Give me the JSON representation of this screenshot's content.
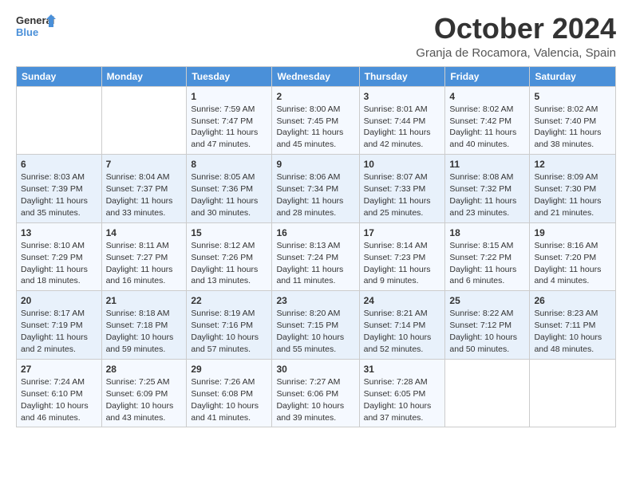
{
  "logo": {
    "line1": "General",
    "line2": "Blue"
  },
  "title": "October 2024",
  "subtitle": "Granja de Rocamora, Valencia, Spain",
  "days_of_week": [
    "Sunday",
    "Monday",
    "Tuesday",
    "Wednesday",
    "Thursday",
    "Friday",
    "Saturday"
  ],
  "weeks": [
    [
      {
        "day": "",
        "info": ""
      },
      {
        "day": "",
        "info": ""
      },
      {
        "day": "1",
        "info": "Sunrise: 7:59 AM\nSunset: 7:47 PM\nDaylight: 11 hours and 47 minutes."
      },
      {
        "day": "2",
        "info": "Sunrise: 8:00 AM\nSunset: 7:45 PM\nDaylight: 11 hours and 45 minutes."
      },
      {
        "day": "3",
        "info": "Sunrise: 8:01 AM\nSunset: 7:44 PM\nDaylight: 11 hours and 42 minutes."
      },
      {
        "day": "4",
        "info": "Sunrise: 8:02 AM\nSunset: 7:42 PM\nDaylight: 11 hours and 40 minutes."
      },
      {
        "day": "5",
        "info": "Sunrise: 8:02 AM\nSunset: 7:40 PM\nDaylight: 11 hours and 38 minutes."
      }
    ],
    [
      {
        "day": "6",
        "info": "Sunrise: 8:03 AM\nSunset: 7:39 PM\nDaylight: 11 hours and 35 minutes."
      },
      {
        "day": "7",
        "info": "Sunrise: 8:04 AM\nSunset: 7:37 PM\nDaylight: 11 hours and 33 minutes."
      },
      {
        "day": "8",
        "info": "Sunrise: 8:05 AM\nSunset: 7:36 PM\nDaylight: 11 hours and 30 minutes."
      },
      {
        "day": "9",
        "info": "Sunrise: 8:06 AM\nSunset: 7:34 PM\nDaylight: 11 hours and 28 minutes."
      },
      {
        "day": "10",
        "info": "Sunrise: 8:07 AM\nSunset: 7:33 PM\nDaylight: 11 hours and 25 minutes."
      },
      {
        "day": "11",
        "info": "Sunrise: 8:08 AM\nSunset: 7:32 PM\nDaylight: 11 hours and 23 minutes."
      },
      {
        "day": "12",
        "info": "Sunrise: 8:09 AM\nSunset: 7:30 PM\nDaylight: 11 hours and 21 minutes."
      }
    ],
    [
      {
        "day": "13",
        "info": "Sunrise: 8:10 AM\nSunset: 7:29 PM\nDaylight: 11 hours and 18 minutes."
      },
      {
        "day": "14",
        "info": "Sunrise: 8:11 AM\nSunset: 7:27 PM\nDaylight: 11 hours and 16 minutes."
      },
      {
        "day": "15",
        "info": "Sunrise: 8:12 AM\nSunset: 7:26 PM\nDaylight: 11 hours and 13 minutes."
      },
      {
        "day": "16",
        "info": "Sunrise: 8:13 AM\nSunset: 7:24 PM\nDaylight: 11 hours and 11 minutes."
      },
      {
        "day": "17",
        "info": "Sunrise: 8:14 AM\nSunset: 7:23 PM\nDaylight: 11 hours and 9 minutes."
      },
      {
        "day": "18",
        "info": "Sunrise: 8:15 AM\nSunset: 7:22 PM\nDaylight: 11 hours and 6 minutes."
      },
      {
        "day": "19",
        "info": "Sunrise: 8:16 AM\nSunset: 7:20 PM\nDaylight: 11 hours and 4 minutes."
      }
    ],
    [
      {
        "day": "20",
        "info": "Sunrise: 8:17 AM\nSunset: 7:19 PM\nDaylight: 11 hours and 2 minutes."
      },
      {
        "day": "21",
        "info": "Sunrise: 8:18 AM\nSunset: 7:18 PM\nDaylight: 10 hours and 59 minutes."
      },
      {
        "day": "22",
        "info": "Sunrise: 8:19 AM\nSunset: 7:16 PM\nDaylight: 10 hours and 57 minutes."
      },
      {
        "day": "23",
        "info": "Sunrise: 8:20 AM\nSunset: 7:15 PM\nDaylight: 10 hours and 55 minutes."
      },
      {
        "day": "24",
        "info": "Sunrise: 8:21 AM\nSunset: 7:14 PM\nDaylight: 10 hours and 52 minutes."
      },
      {
        "day": "25",
        "info": "Sunrise: 8:22 AM\nSunset: 7:12 PM\nDaylight: 10 hours and 50 minutes."
      },
      {
        "day": "26",
        "info": "Sunrise: 8:23 AM\nSunset: 7:11 PM\nDaylight: 10 hours and 48 minutes."
      }
    ],
    [
      {
        "day": "27",
        "info": "Sunrise: 7:24 AM\nSunset: 6:10 PM\nDaylight: 10 hours and 46 minutes."
      },
      {
        "day": "28",
        "info": "Sunrise: 7:25 AM\nSunset: 6:09 PM\nDaylight: 10 hours and 43 minutes."
      },
      {
        "day": "29",
        "info": "Sunrise: 7:26 AM\nSunset: 6:08 PM\nDaylight: 10 hours and 41 minutes."
      },
      {
        "day": "30",
        "info": "Sunrise: 7:27 AM\nSunset: 6:06 PM\nDaylight: 10 hours and 39 minutes."
      },
      {
        "day": "31",
        "info": "Sunrise: 7:28 AM\nSunset: 6:05 PM\nDaylight: 10 hours and 37 minutes."
      },
      {
        "day": "",
        "info": ""
      },
      {
        "day": "",
        "info": ""
      }
    ]
  ]
}
